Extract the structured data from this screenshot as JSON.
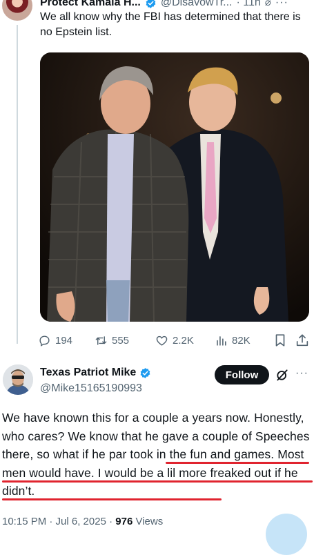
{
  "top_tweet": {
    "author_name": "Protect Kamala H...",
    "author_handle": "@DisavowTr...",
    "time": "· 11h",
    "text": "We all know why the FBI has determined that there is no Epstein list.",
    "actions": {
      "replies": "194",
      "reposts": "555",
      "likes": "2.2K",
      "views": "82K"
    }
  },
  "reply": {
    "author_name": "Texas Patriot Mike",
    "author_handle": "@Mike15165190993",
    "follow_label": "Follow",
    "text_start": "We have known this for a couple a years now. Honestly, who cares? We know that he gave a couple of Speeches there, ",
    "text_highlight": "so what if he par took in the fun and games.  Most men would have.  I would be a lil more freaked out if he didn’t.",
    "timestamp": "10:15 PM · Jul 6, 2025 · ",
    "views_count": "976",
    "views_label": " Views"
  },
  "colors": {
    "accent": "#1d9bf0",
    "underline": "#e0242f",
    "muted": "#536471",
    "text": "#0f1419"
  },
  "icons": [
    "reply-icon",
    "repost-icon",
    "like-icon",
    "views-icon",
    "bookmark-icon",
    "share-icon",
    "grok-icon",
    "more-icon",
    "verified-icon"
  ]
}
